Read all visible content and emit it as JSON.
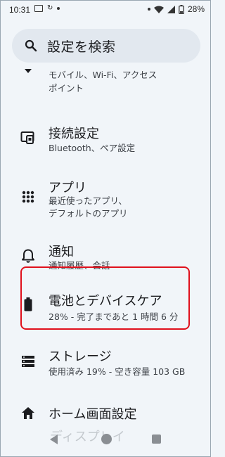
{
  "status_bar": {
    "time": "10:31",
    "battery_pct": "28%"
  },
  "search": {
    "placeholder": "設定を検索",
    "icon": "search-icon"
  },
  "items": [
    {
      "id": "network",
      "icon": "wifi-icon",
      "title": "",
      "subtitle_lines": [
        "モバイル、Wi-Fi、アクセス",
        "ポイント"
      ]
    },
    {
      "id": "connected-devices",
      "icon": "connected-devices-icon",
      "title": "接続設定",
      "subtitle_lines": [
        "Bluetooth、ペア設定"
      ]
    },
    {
      "id": "apps",
      "icon": "apps-grid-icon",
      "title": "アプリ",
      "subtitle_lines": [
        "最近使ったアプリ、",
        "デフォルトのアプリ"
      ]
    },
    {
      "id": "notifications",
      "icon": "bell-icon",
      "title": "通知",
      "subtitle_lines": [
        "通知履歴、会話"
      ]
    },
    {
      "id": "battery",
      "icon": "battery-icon",
      "title": "電池とデバイスケア",
      "subtitle_lines": [
        "28% - 完了まであと 1 時間 6 分"
      ]
    },
    {
      "id": "storage",
      "icon": "storage-icon",
      "title": "ストレージ",
      "subtitle_lines": [
        "使用済み 19% - 空き容量 103 GB"
      ]
    },
    {
      "id": "home-screen",
      "icon": "home-icon",
      "title": "ホーム画面設定",
      "subtitle_lines": []
    }
  ],
  "nav_peek_text": "ディスプレイ",
  "colors": {
    "background": "#f1f5f9",
    "search_bg": "#e2e8ef",
    "highlight": "#e0101c"
  }
}
